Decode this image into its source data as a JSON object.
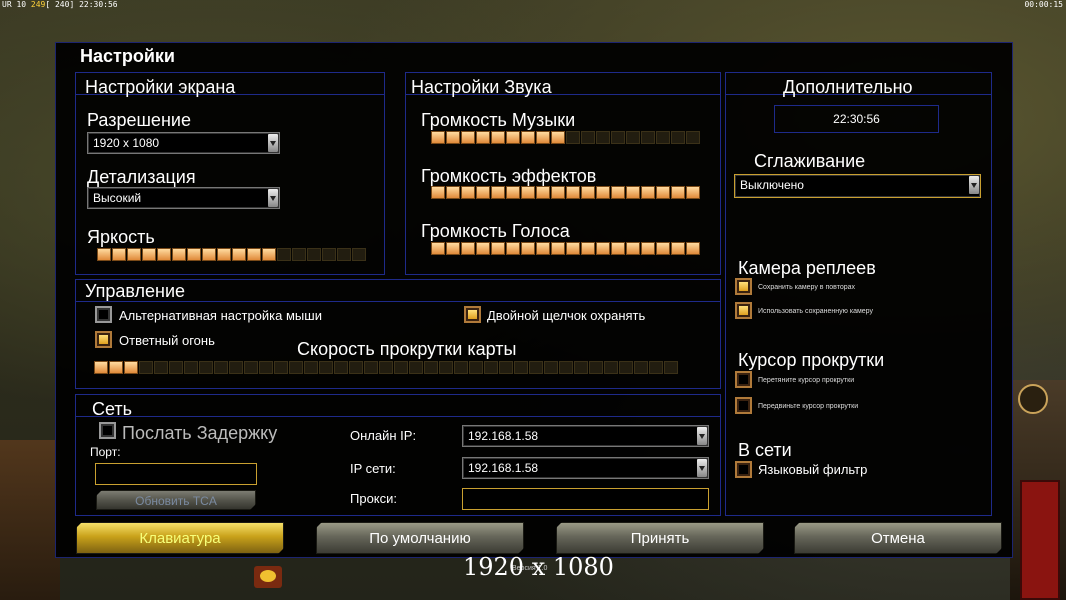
{
  "hud": {
    "left_prefix": "UR 10 ",
    "left_value": "249",
    "left_sub": "[ 240]",
    "left_time": " 22:30:56",
    "right_time": "00:00:15"
  },
  "dialog": {
    "title": "Настройки",
    "screen": {
      "title": "Настройки экрана",
      "resolution_label": "Разрешение",
      "resolution_value": "1920 x 1080",
      "detail_label": "Детализация",
      "detail_value": "Высокий",
      "brightness_label": "Яркость",
      "brightness_level": 0.67
    },
    "sound": {
      "title": "Настройки Звука",
      "music_label": "Громкость Музыки",
      "music_level": 0.5,
      "effects_label": "Громкость эффектов",
      "effects_level": 1.0,
      "voice_label": "Громкость Голоса",
      "voice_level": 1.0
    },
    "extra": {
      "title": "Дополнительно",
      "clock": "22:30:56",
      "antialias_label": "Сглаживание",
      "antialias_value": "Выключено",
      "replay_camera_label": "Камера реплеев",
      "save_camera_label": "Сохранить камеру в повторах",
      "use_saved_camera_label": "Использовать сохраненную камеру",
      "scroll_cursor_label": "Курсор прокрутки",
      "drag_cursor_label": "Перетяните курсор прокрутки",
      "move_cursor_label": "Передвиньте курсор прокрутки",
      "online_label": "В сети",
      "language_filter_label": "Языковый фильтр"
    },
    "controls": {
      "title": "Управление",
      "alt_mouse_label": "Альтернативная настройка мыши",
      "double_click_label": "Двойной щелчок охранять",
      "return_fire_label": "Ответный огонь",
      "scroll_speed_label": "Скорость прокрутки карты",
      "scroll_speed_level": 0.07
    },
    "network": {
      "title": "Сеть",
      "send_delay_label": "Послать Задержку",
      "port_label": "Порт:",
      "update_tca_label": "Обновить TCA",
      "online_ip_label": "Онлайн IP:",
      "online_ip_value": "192.168.1.58",
      "lan_ip_label": "IP сети:",
      "lan_ip_value": "192.168.1.58",
      "proxy_label": "Прокси:"
    },
    "buttons": {
      "keyboard": "Клавиатура",
      "defaults": "По умолчанию",
      "accept": "Принять",
      "cancel": "Отмена"
    }
  },
  "overlay_resolution": "1920 x 1080",
  "version_text": "Версия 1.0",
  "colors": {
    "panel_border": "#1e2a8a",
    "slider_on": "#e08a3a",
    "accent_gold": "#c9a030"
  }
}
